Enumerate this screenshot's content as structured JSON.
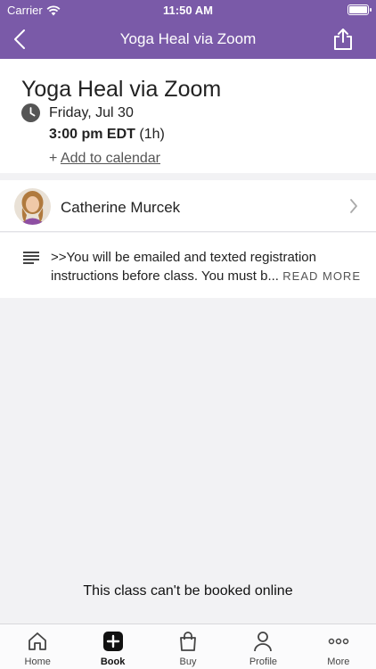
{
  "status_bar": {
    "carrier": "Carrier",
    "time": "11:50 AM"
  },
  "nav": {
    "title": "Yoga Heal via Zoom"
  },
  "class": {
    "title": "Yoga Heal via Zoom",
    "date": "Friday, Jul 30",
    "time": "3:00 pm EDT",
    "duration": "(1h)",
    "add_calendar_prefix": "+",
    "add_calendar_label": "Add to calendar"
  },
  "instructor": {
    "name": "Catherine Murcek"
  },
  "description": {
    "line1": ">>You will be emailed and texted registration",
    "line2": "instructions before class. You must b...",
    "read_more": "READ MORE"
  },
  "booking_note": "This class can't be booked online",
  "tabs": [
    {
      "label": "Home",
      "icon": "home-icon"
    },
    {
      "label": "Book",
      "icon": "plus-square-icon"
    },
    {
      "label": "Buy",
      "icon": "shopping-bag-icon"
    },
    {
      "label": "Profile",
      "icon": "person-icon"
    },
    {
      "label": "More",
      "icon": "ellipsis-icon"
    }
  ],
  "colors": {
    "brand": "#7a5aa8"
  }
}
